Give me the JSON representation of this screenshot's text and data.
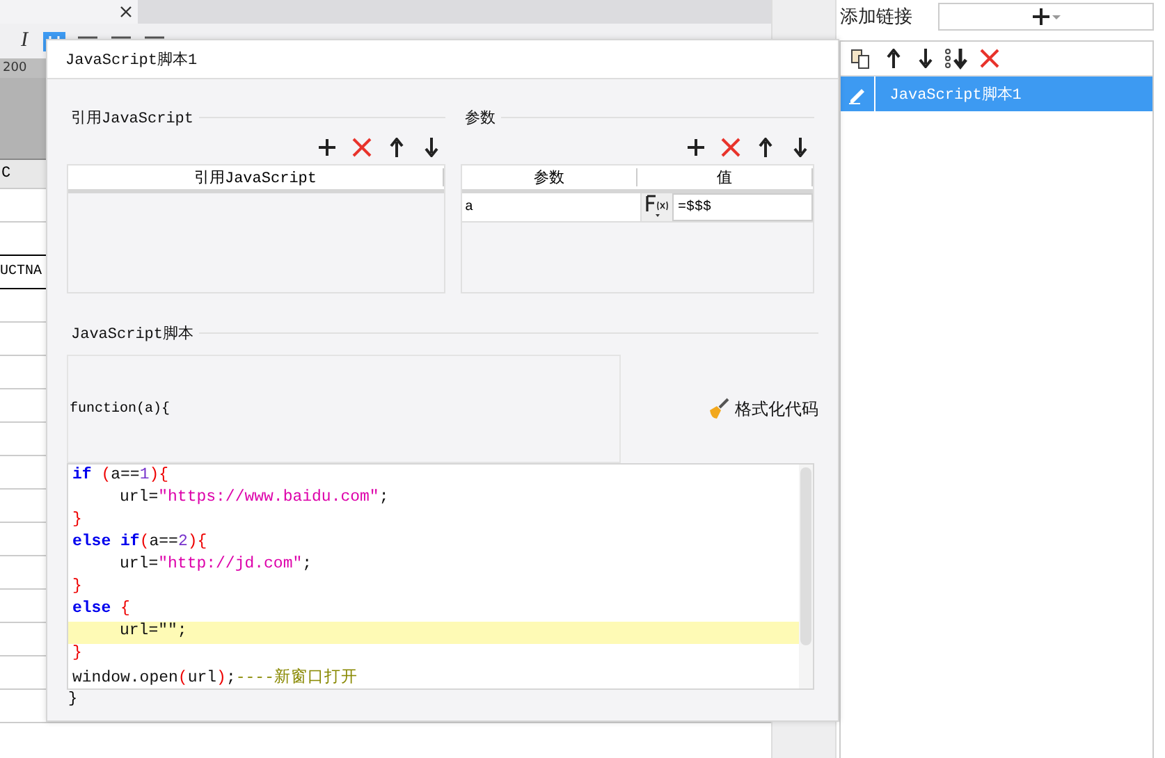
{
  "editor": {
    "italic_button": "I",
    "ruler_mark": "200",
    "column_header": "C",
    "cell": "UCTNA"
  },
  "dialog": {
    "title": "JavaScript脚本1",
    "references": {
      "legend": "引用JavaScript",
      "column": "引用JavaScript"
    },
    "parameters": {
      "legend": "参数",
      "columns": [
        "参数",
        "值"
      ],
      "rows": [
        {
          "name": "a",
          "value": "=$$$"
        }
      ]
    },
    "script": {
      "legend": "JavaScript脚本",
      "signature": "function(a){",
      "format_button": "格式化代码",
      "closing": "}",
      "lines": [
        {
          "indented": false,
          "highlighted": false,
          "tokens": [
            {
              "kind": "keyword",
              "text": "if "
            },
            {
              "kind": "paren",
              "text": "("
            },
            {
              "kind": "plain",
              "text": "a=="
            },
            {
              "kind": "number",
              "text": "1"
            },
            {
              "kind": "paren",
              "text": "){"
            }
          ]
        },
        {
          "indented": true,
          "highlighted": false,
          "tokens": [
            {
              "kind": "plain",
              "text": "url="
            },
            {
              "kind": "string",
              "text": "\"https://www.baidu.com\""
            },
            {
              "kind": "plain",
              "text": ";"
            }
          ]
        },
        {
          "indented": false,
          "highlighted": false,
          "tokens": [
            {
              "kind": "paren",
              "text": "}"
            }
          ]
        },
        {
          "indented": false,
          "highlighted": false,
          "tokens": [
            {
              "kind": "keyword",
              "text": "else if"
            },
            {
              "kind": "paren",
              "text": "("
            },
            {
              "kind": "plain",
              "text": "a=="
            },
            {
              "kind": "number",
              "text": "2"
            },
            {
              "kind": "paren",
              "text": "){"
            }
          ]
        },
        {
          "indented": true,
          "highlighted": false,
          "tokens": [
            {
              "kind": "plain",
              "text": "url="
            },
            {
              "kind": "string",
              "text": "\"http://jd.com\""
            },
            {
              "kind": "plain",
              "text": ";"
            }
          ]
        },
        {
          "indented": false,
          "highlighted": false,
          "tokens": [
            {
              "kind": "paren",
              "text": "}"
            }
          ]
        },
        {
          "indented": false,
          "highlighted": false,
          "tokens": [
            {
              "kind": "keyword",
              "text": "else "
            },
            {
              "kind": "paren",
              "text": "{"
            }
          ]
        },
        {
          "indented": true,
          "highlighted": true,
          "tokens": [
            {
              "kind": "plain",
              "text": "url=\"\";"
            }
          ]
        },
        {
          "indented": false,
          "highlighted": false,
          "tokens": [
            {
              "kind": "paren",
              "text": "}"
            }
          ]
        },
        {
          "indented": false,
          "highlighted": false,
          "tokens": [
            {
              "kind": "plain",
              "text": "window.open"
            },
            {
              "kind": "paren",
              "text": "("
            },
            {
              "kind": "plain",
              "text": "url"
            },
            {
              "kind": "paren",
              "text": ")"
            },
            {
              "kind": "plain",
              "text": ";"
            },
            {
              "kind": "comment",
              "text": "----新窗口打开"
            }
          ]
        }
      ]
    }
  },
  "side_panel": {
    "add_label": "添加链接",
    "items": [
      {
        "label": "JavaScript脚本1",
        "selected": true
      }
    ]
  }
}
